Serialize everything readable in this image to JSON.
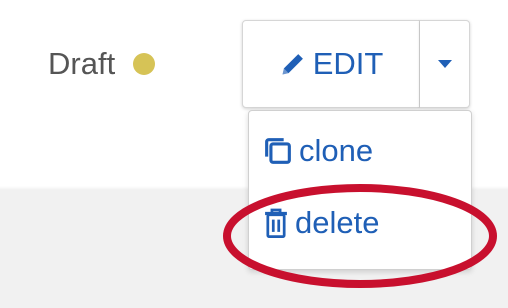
{
  "status": {
    "label": "Draft",
    "dot_color": "#d6c356"
  },
  "edit_button": {
    "label": "EDIT",
    "icon": "pencil-icon"
  },
  "dropdown_toggle": {
    "icon": "caret-down-icon"
  },
  "menu": {
    "items": [
      {
        "label": "clone",
        "icon": "clone-icon"
      },
      {
        "label": "delete",
        "icon": "trash-icon"
      }
    ]
  },
  "colors": {
    "accent": "#1f5fb6",
    "status_text": "#555555",
    "highlight": "#c8102e"
  }
}
